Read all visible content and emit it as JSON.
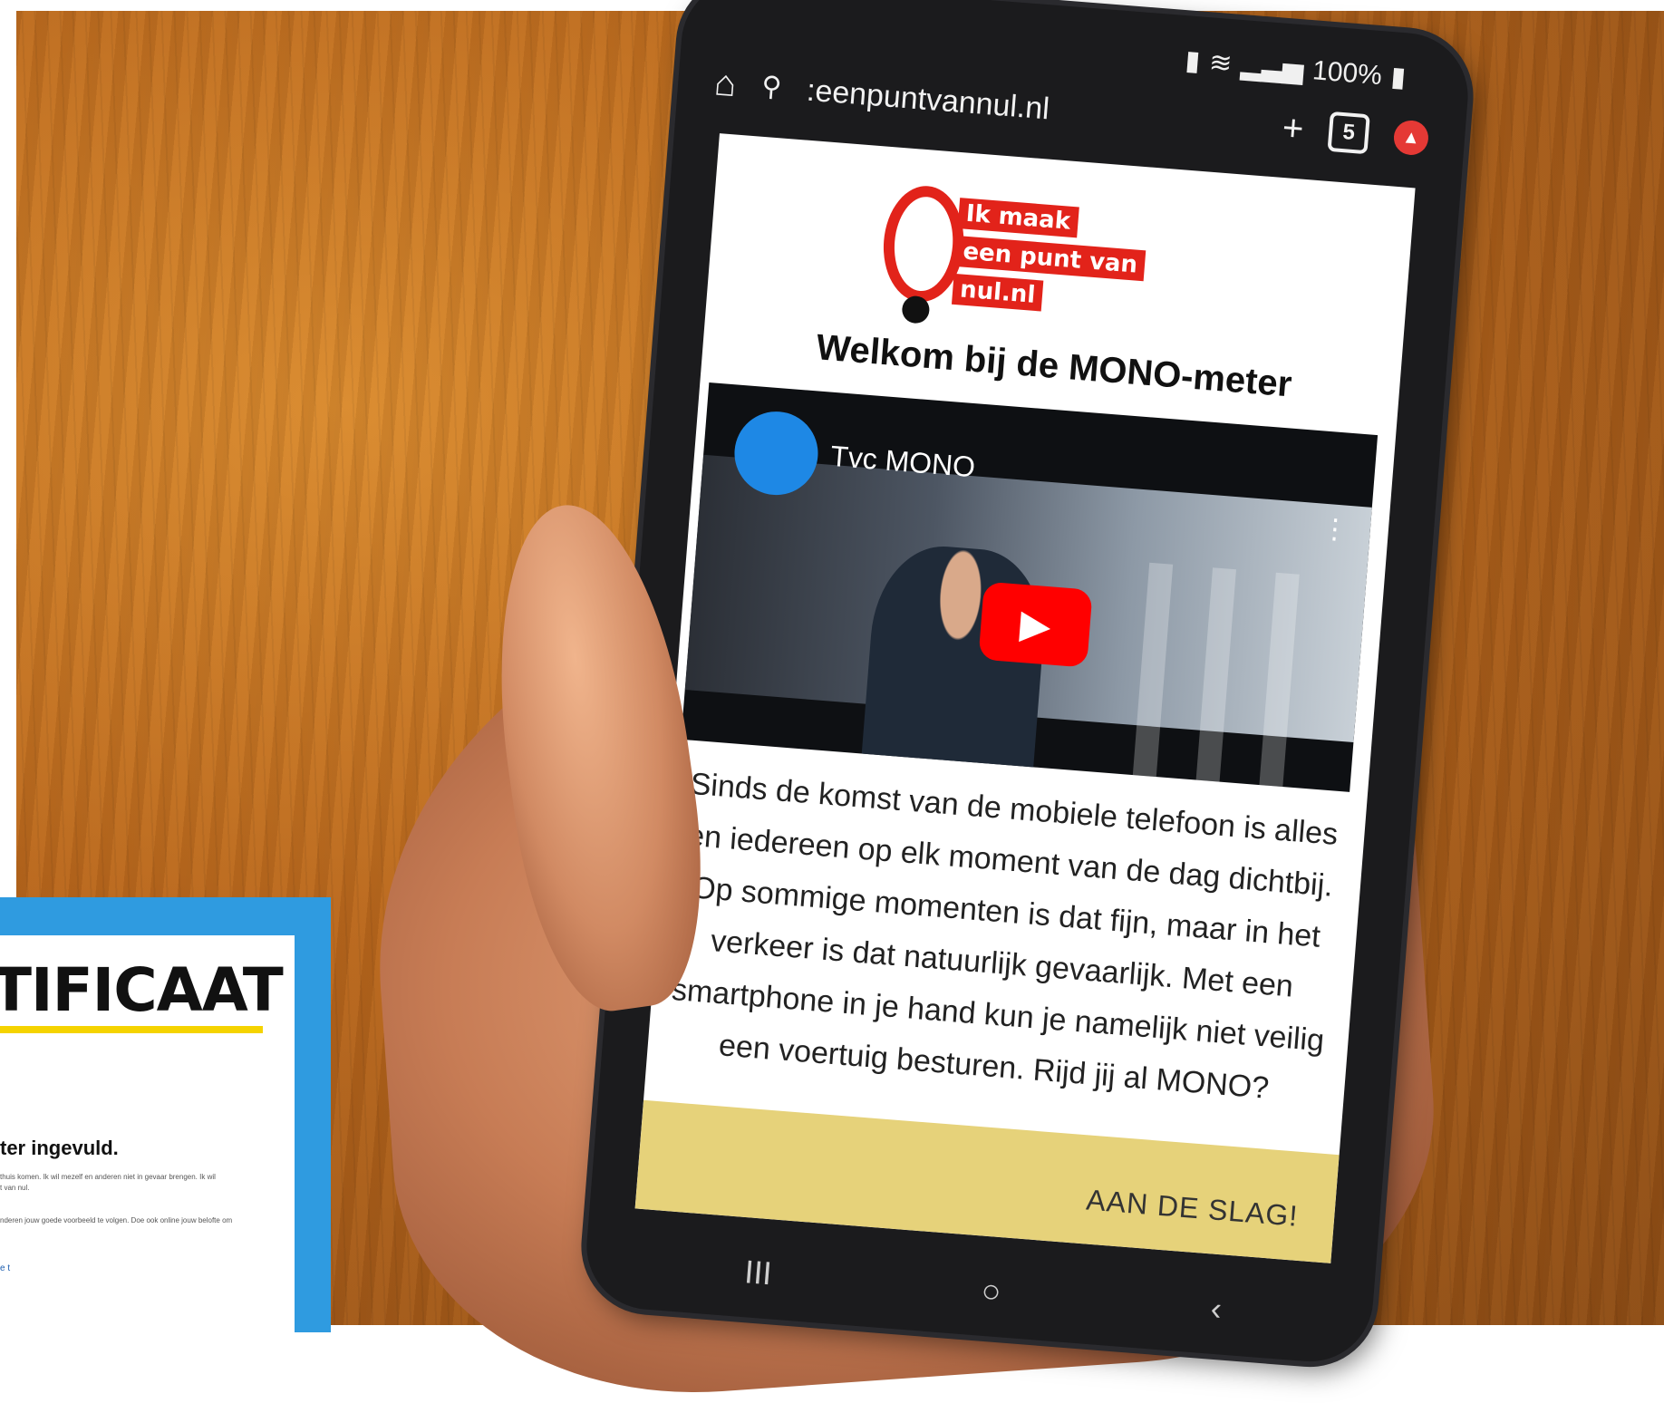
{
  "status_bar": {
    "battery": "100%"
  },
  "browser": {
    "url": ":eenpuntvannul.nl",
    "tab_count": "5"
  },
  "page": {
    "logo_lines": [
      "Ik maak",
      "een punt van",
      "nul.nl"
    ],
    "heading": "Welkom bij de MONO-meter",
    "video": {
      "title": "Tvc MONO"
    },
    "body": "Sinds de komst van de mobiele telefoon is alles en iedereen op elk moment van de dag dichtbij. Op sommige momenten is dat fijn, maar in het verkeer is dat natuurlijk gevaarlijk. Met een smartphone in je hand kun je namelijk niet veilig een voertuig besturen. Rijd jij al MONO?",
    "cta": "AAN DE SLAG!"
  },
  "nav": {
    "recent": "III",
    "home": "○",
    "back": "‹"
  },
  "certificate": {
    "title": "TIFICAAT",
    "subtitle": "ter ingevuld.",
    "line1": "thuis komen. Ik wil mezelf en anderen niet in gevaar brengen. Ik wil",
    "line2": "t van nul.",
    "line3": "nderen jouw goede voorbeeld te volgen. Doe ook online jouw belofte om",
    "blue": "e\nt"
  },
  "colors": {
    "brand_red": "#e2231a",
    "cta_yellow": "#e6d27a",
    "cert_blue": "#2f9be0"
  }
}
